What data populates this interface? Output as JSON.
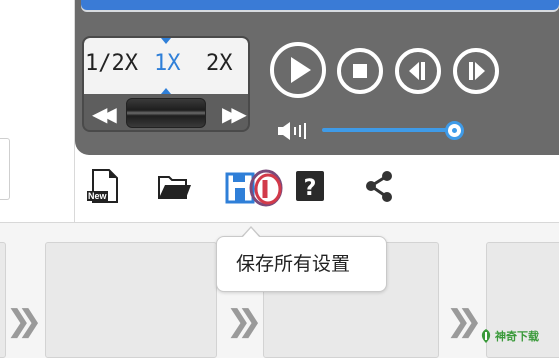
{
  "speed": {
    "options": [
      "1/2X",
      "1X",
      "2X"
    ],
    "selected": "1X"
  },
  "playback": {
    "buttons": [
      "play-icon",
      "stop-icon",
      "previous-frame-icon",
      "next-frame-icon"
    ]
  },
  "volume": {
    "level_fraction": 0.93
  },
  "toolbar": {
    "new_label": "New",
    "icons": [
      "new-file-icon",
      "open-folder-icon",
      "save-settings-icon",
      "help-icon",
      "share-icon"
    ]
  },
  "tooltip": {
    "text": "保存所有设置"
  },
  "watermark": {
    "text": "神奇下载"
  },
  "colors": {
    "accent_blue": "#2f7fd8",
    "panel_gray": "#6b6b6b",
    "highlight_red": "#d23a4a"
  }
}
